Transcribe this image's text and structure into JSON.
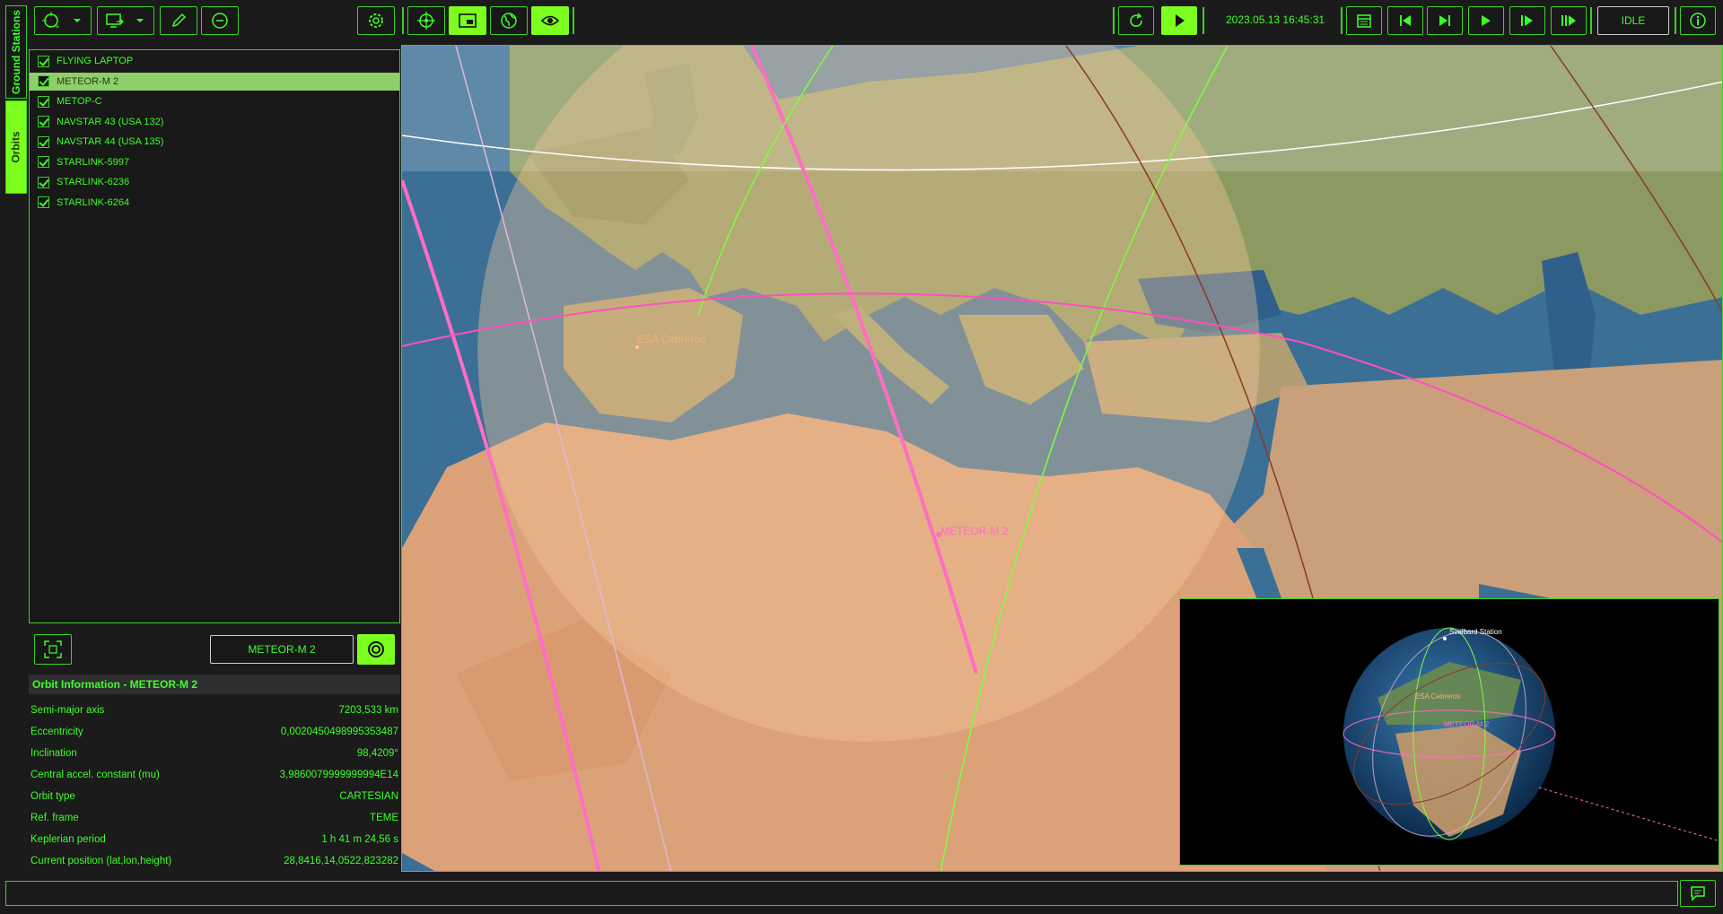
{
  "toolbar_left": {
    "add_station_icon": "target-add-icon",
    "import_icon": "import-icon",
    "edit_icon": "pencil-icon",
    "remove_icon": "minus-icon",
    "settings_icon": "gear-icon"
  },
  "view_toolbar": {
    "items": [
      "crosshair-icon",
      "pip-icon",
      "globe-icon",
      "eye-icon"
    ]
  },
  "time_toolbar": {
    "datetime": "2023.05.13 16:45:31",
    "status": "IDLE"
  },
  "side_tabs": {
    "ground_stations": "Ground Stations",
    "orbits": "Orbits"
  },
  "orbits": [
    {
      "label": "FLYING LAPTOP",
      "checked": true,
      "selected": false
    },
    {
      "label": "METEOR-M 2",
      "checked": true,
      "selected": true
    },
    {
      "label": "METOP-C",
      "checked": true,
      "selected": false
    },
    {
      "label": "NAVSTAR 43 (USA 132)",
      "checked": true,
      "selected": false
    },
    {
      "label": "NAVSTAR 44 (USA 135)",
      "checked": true,
      "selected": false
    },
    {
      "label": "STARLINK-5997",
      "checked": true,
      "selected": false
    },
    {
      "label": "STARLINK-6236",
      "checked": true,
      "selected": false
    },
    {
      "label": "STARLINK-6264",
      "checked": true,
      "selected": false
    }
  ],
  "selection": {
    "name": "METEOR-M 2"
  },
  "orbit_info": {
    "title": "Orbit Information - METEOR-M 2",
    "rows": [
      {
        "label": "Semi-major axis",
        "value": "7203,533 km"
      },
      {
        "label": "Eccentricity",
        "value": "0,0020450498995353487"
      },
      {
        "label": "Inclination",
        "value": "98,4209°"
      },
      {
        "label": "Central accel. constant (mu)",
        "value": "3,9860079999999994E14"
      },
      {
        "label": "Orbit type",
        "value": "CARTESIAN"
      },
      {
        "label": "Ref. frame",
        "value": "TEME"
      },
      {
        "label": "Keplerian period",
        "value": "1 h 41 m 24,56 s"
      },
      {
        "label": "Current position (lat,lon,height)",
        "value": "28,8416,14,0522,823282"
      }
    ]
  },
  "map": {
    "station_label": "ESA Cebreros",
    "satellite_label": "METEOR-M 2"
  },
  "inset": {
    "station1": "Svalbard Station",
    "station2": "ESA Cebreros",
    "satellite": "METEOR-M 2"
  },
  "colors": {
    "accent": "#3cff2a",
    "active": "#7cff1e",
    "orbit_pink": "#ff5fc0",
    "orbit_green": "#7cff40",
    "orbit_brown": "#8a3a20",
    "footprint": "#f7c89a"
  }
}
